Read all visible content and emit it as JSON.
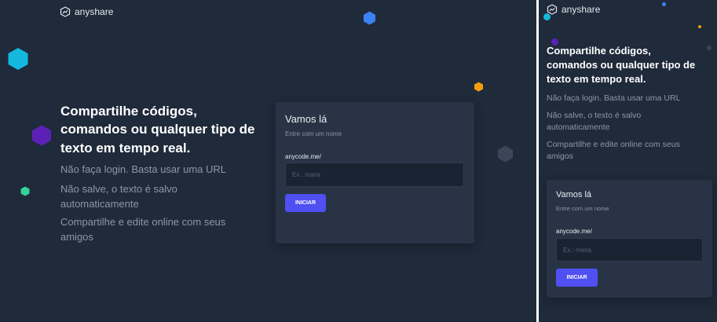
{
  "brand": {
    "name": "anyshare"
  },
  "hero": {
    "title_lines": [
      "Compartilhe códigos,",
      "comandos ou qualquer tipo de",
      "texto em tempo real."
    ],
    "features": [
      [
        "Não faça login. Basta usar uma URL"
      ],
      [
        "Não salve, o texto é salvo",
        "automaticamente"
      ],
      [
        "Compartilhe e edite online com seus",
        "amigos"
      ]
    ]
  },
  "card": {
    "title": "Vamos lá",
    "subtitle": "Entre com um nome",
    "url_prefix": "anycode.me/",
    "name_placeholder": "Ex.: maria",
    "start_label": "INICIAR"
  },
  "colors": {
    "background": "#1f2a3a",
    "card": "#283446",
    "accent": "#4f4ff2",
    "hex_cyan": "#14b8de",
    "hex_blue": "#3b82f6",
    "hex_purple": "#5b21b6",
    "hex_orange": "#f59e0b",
    "hex_green": "#34d399",
    "hex_gray": "#3b4658"
  }
}
